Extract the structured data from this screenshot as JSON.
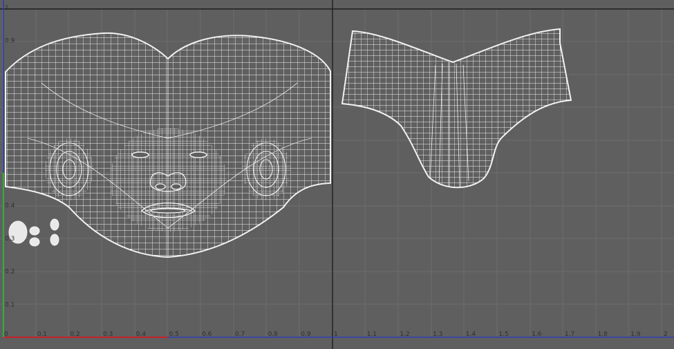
{
  "editor": {
    "name": "UV Texture Editor",
    "colors": {
      "background": "#5f5f5f",
      "grid_minor": "#6c6c6c",
      "grid_major": "#1e1e1e",
      "wire": "#f2f2f2",
      "u_axis": "#c8202a",
      "v_axis": "#2fae3a",
      "blue_axis": "#2e3fb0",
      "tick_text": "#2f2f2f"
    }
  },
  "axes": {
    "u_labels": [
      "0",
      "0.1",
      "0.2",
      "0.3",
      "0.4",
      "0.5",
      "0.6",
      "0.7",
      "0.8",
      "0.9",
      "1",
      "1.1",
      "1.2",
      "1.3",
      "1.4",
      "1.5",
      "1.6",
      "1.7",
      "1.8",
      "1.9",
      "2"
    ],
    "v_labels": [
      "0.1",
      "0.2",
      "0.3",
      "0.4",
      "0.9",
      "1"
    ]
  },
  "uv_shells": [
    {
      "name": "head-uv-shell"
    },
    {
      "name": "neck-uv-shell"
    },
    {
      "name": "eye-uv-shells"
    }
  ]
}
